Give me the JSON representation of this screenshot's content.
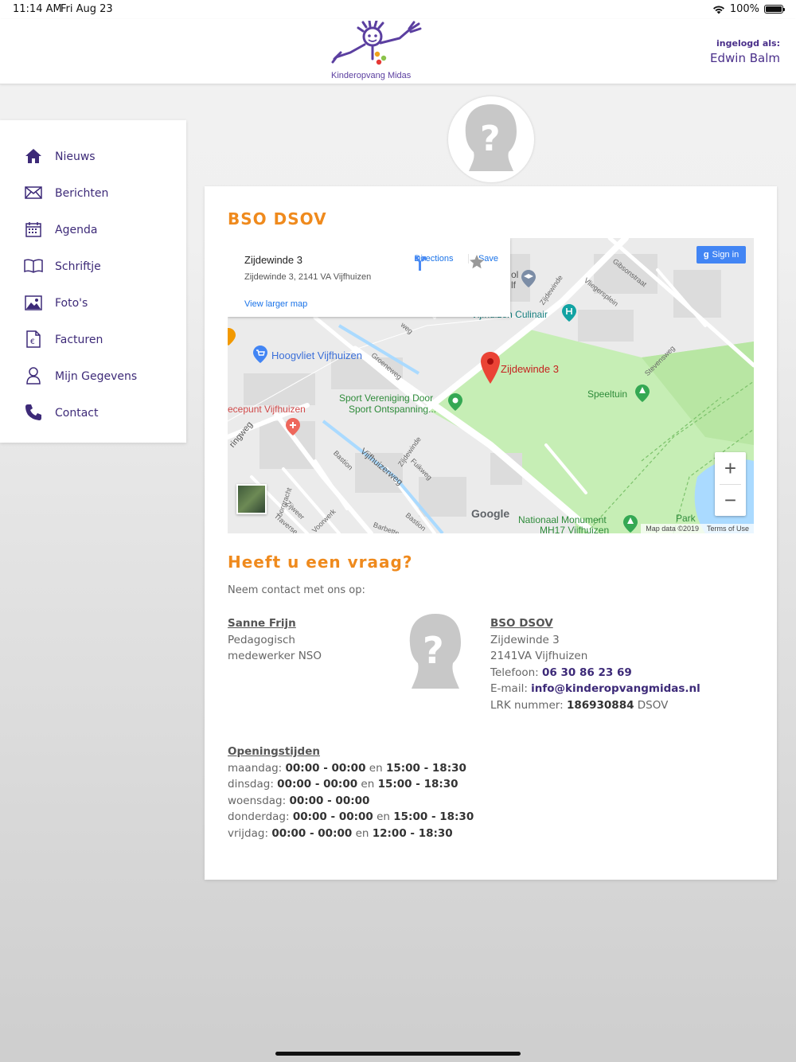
{
  "status_bar": {
    "time": "11:14 AM",
    "date": "Fri Aug 23",
    "battery": "100%",
    "battery_level": 100
  },
  "header": {
    "logo_text": "Kinderopvang Midas",
    "login_label": "ingelogd als:",
    "user_name": "Edwin Balm",
    "brand_color": "#4a2f8a"
  },
  "sidebar": {
    "items": [
      {
        "label": "Nieuws",
        "icon": "home-icon"
      },
      {
        "label": "Berichten",
        "icon": "envelope-icon"
      },
      {
        "label": "Agenda",
        "icon": "calendar-icon"
      },
      {
        "label": "Schriftje",
        "icon": "book-icon"
      },
      {
        "label": "Foto's",
        "icon": "image-icon"
      },
      {
        "label": "Facturen",
        "icon": "invoice-icon"
      },
      {
        "label": "Mijn Gegevens",
        "icon": "user-icon"
      },
      {
        "label": "Contact",
        "icon": "phone-icon"
      }
    ]
  },
  "location": {
    "title": "BSO DSOV",
    "accent_color": "#ef8a1d"
  },
  "map": {
    "popup_title": "Zijdewinde 3",
    "popup_address": "Zijdewinde 3, 2141 VA Vijfhuizen",
    "popup_link": "View larger map",
    "directions_label": "Directions",
    "save_label": "Save",
    "sign_in_label": "Sign in",
    "zoom_in": "+",
    "zoom_out": "−",
    "marker_label": "Zijdewinde 3",
    "places": {
      "hoogvliet": "Hoogvliet Vijfhuizen",
      "sport1": "Sport Vereniging Door",
      "sport2": "Sport Ontspanning...",
      "speeltuin": "Speeltuin",
      "culinair": "Vijfhuizen Culinair",
      "cepunt": "ecepunt Vijfhuizen",
      "park": "Park",
      "monument1": "Nationaal Monument",
      "monument2": "MH17 Vijfhuizen",
      "school1": "ol",
      "school2": "lf"
    },
    "streets": {
      "gibsonstraat": "Gibsonstraat",
      "vliegersplein": "Vliegersplein",
      "zijdewinde1": "Zijdewinde",
      "zijdewinde2": "Zijdewinde",
      "stevensweg": "Stevensweg",
      "groeneweg": "Groeneweg",
      "vijfhuizerweg": "Vijfhuizerweg",
      "fuikweg": "Fuikweg",
      "bastion1": "Bastion",
      "bastion2": "Bastion",
      "ringweg": "ringweg",
      "zijweer": "Zijweer",
      "traverse": "Traverse",
      "voorwerk": "Voorwerk",
      "oorgracht": "oorgracht",
      "barbette": "Barbette",
      "weg": "weg"
    },
    "google_label": "Google",
    "map_data": "Map data ©2019",
    "terms": "Terms of Use"
  },
  "question": {
    "title": "Heeft u een vraag?",
    "intro": "Neem contact met ons op:"
  },
  "contact_person": {
    "name": "Sanne Frijn",
    "role_line1": "Pedagogisch",
    "role_line2": "medewerker NSO"
  },
  "organization": {
    "name": "BSO DSOV",
    "street": "Zijdewinde 3",
    "city": "2141VA Vijfhuizen",
    "phone_label": "Telefoon:",
    "phone": "06 30 86 23 69",
    "email_label": "E-mail:",
    "email": "info@kinderopvangmidas.nl",
    "lrk_label": "LRK nummer:",
    "lrk_number": "186930884",
    "lrk_suffix": "DSOV"
  },
  "hours": {
    "title": "Openingstijden",
    "joiner": "en",
    "days": [
      {
        "day": "maandag:",
        "slot1": "00:00 - 00:00",
        "slot2": "15:00 - 18:30"
      },
      {
        "day": "dinsdag:",
        "slot1": "00:00 - 00:00",
        "slot2": "15:00 - 18:30"
      },
      {
        "day": "woensdag:",
        "slot1": "00:00 - 00:00",
        "slot2": ""
      },
      {
        "day": "donderdag:",
        "slot1": "00:00 - 00:00",
        "slot2": "15:00 - 18:30"
      },
      {
        "day": "vrijdag:",
        "slot1": "00:00 - 00:00",
        "slot2": "12:00 - 18:30"
      }
    ]
  }
}
